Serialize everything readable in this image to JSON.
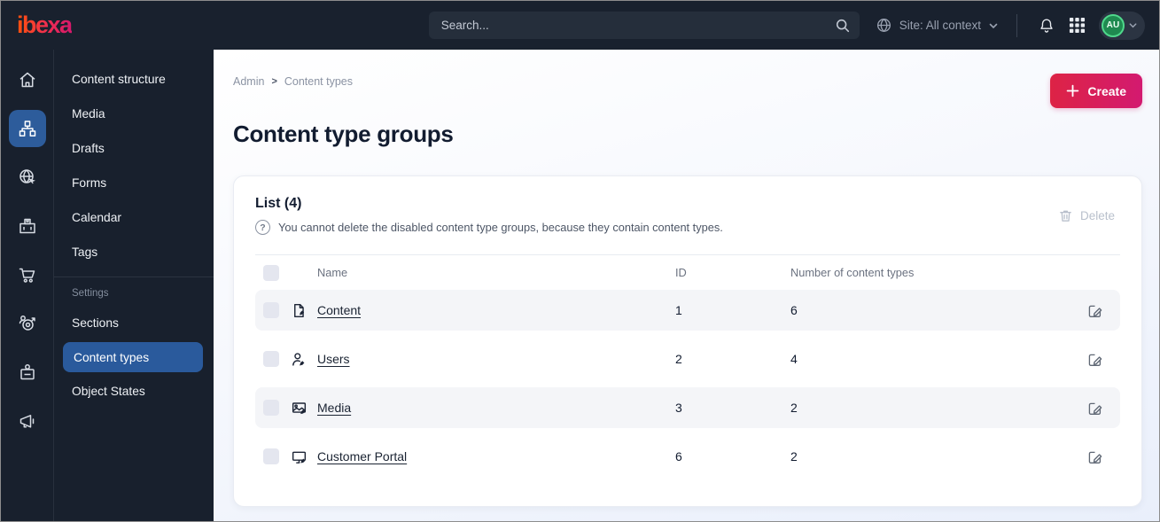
{
  "topbar": {
    "logo": "ibexa",
    "search": {
      "placeholder": "Search..."
    },
    "site_selector": {
      "label": "Site: All context"
    },
    "avatar": {
      "initials": "AU"
    },
    "icons": [
      "globe-icon",
      "chevron-down-icon",
      "bell-icon",
      "app-grid-icon",
      "search-icon"
    ]
  },
  "rail_icons": [
    "home-icon",
    "content-tree-icon",
    "site-globe-icon",
    "products-box-icon",
    "commerce-cart-icon",
    "personalization-target-icon",
    "admin-badge-icon",
    "marketing-megaphone-icon"
  ],
  "sidebar": {
    "items": [
      "Content structure",
      "Media",
      "Drafts",
      "Forms",
      "Calendar",
      "Tags"
    ],
    "section_label": "Settings",
    "settings_items": [
      "Sections",
      "Content types",
      "Object States"
    ],
    "active_item": "Content types"
  },
  "breadcrumb": {
    "items": [
      "Admin",
      "Content types"
    ],
    "separator": ">"
  },
  "page": {
    "title": "Content type groups"
  },
  "actions": {
    "create_label": "Create",
    "delete_label": "Delete"
  },
  "card": {
    "list_title": "List (4)",
    "info_text": "You cannot delete the disabled content type groups, because they contain content types.",
    "help_glyph": "?",
    "table": {
      "columns": [
        "Name",
        "ID",
        "Number of content types"
      ],
      "rows": [
        {
          "icon": "content-file-edit-icon",
          "name": "Content",
          "id": "1",
          "count": "6"
        },
        {
          "icon": "users-edit-icon",
          "name": "Users",
          "id": "2",
          "count": "4"
        },
        {
          "icon": "media-image-edit-icon",
          "name": "Media",
          "id": "3",
          "count": "2"
        },
        {
          "icon": "portal-monitor-edit-icon",
          "name": "Customer Portal",
          "id": "6",
          "count": "2"
        }
      ]
    }
  },
  "colors": {
    "topbar_bg": "#19212e",
    "accent_blue": "#2a5a9c",
    "brand_gradient_start": "#ff4e12",
    "brand_gradient_end": "#d6186c",
    "create_gradient_start": "#dd2345",
    "create_gradient_end": "#d31a70",
    "avatar_green": "#1f8a50",
    "row_stripe": "#f4f5f8"
  }
}
